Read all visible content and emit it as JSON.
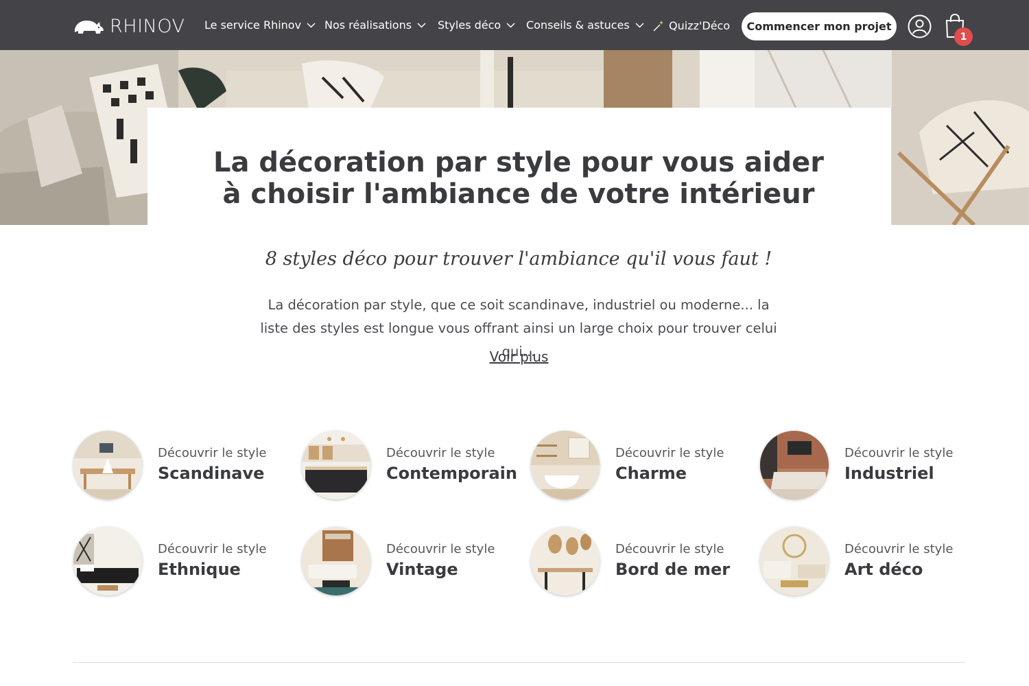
{
  "brand": {
    "name": "RHINOV"
  },
  "nav": {
    "items": [
      {
        "label": "Le service Rhinov",
        "has_dropdown": true
      },
      {
        "label": "Nos réalisations",
        "has_dropdown": true
      },
      {
        "label": "Styles déco",
        "has_dropdown": true
      },
      {
        "label": "Conseils & astuces",
        "has_dropdown": true
      },
      {
        "label": "Quizz'Déco",
        "has_dropdown": false,
        "icon": "magic-wand-icon"
      }
    ],
    "cta_label": "Commencer mon projet",
    "cart_count": "1",
    "bg_color": "#434348"
  },
  "hero": {
    "title": "La décoration par style pour vous aider à choisir l'ambiance de votre intérieur",
    "subtitle": "8 styles déco pour trouver l'ambiance qu'il vous faut !",
    "description": "La décoration par style, que ce soit scandinave, industriel ou moderne... la liste des styles est longue vous offrant ainsi un large choix pour trouver celui qui...",
    "more_label": "Voir plus"
  },
  "styles": [
    {
      "kicker": "Découvrir le style",
      "name": "Scandinave"
    },
    {
      "kicker": "Découvrir le style",
      "name": "Contemporain"
    },
    {
      "kicker": "Découvrir le style",
      "name": "Charme"
    },
    {
      "kicker": "Découvrir le style",
      "name": "Industriel"
    },
    {
      "kicker": "Découvrir le style",
      "name": "Ethnique"
    },
    {
      "kicker": "Découvrir le style",
      "name": "Vintage"
    },
    {
      "kicker": "Découvrir le style",
      "name": "Bord de mer"
    },
    {
      "kicker": "Découvrir le style",
      "name": "Art déco"
    }
  ],
  "colors": {
    "text": "#3a3b3f",
    "badge": "#e04d4d"
  }
}
